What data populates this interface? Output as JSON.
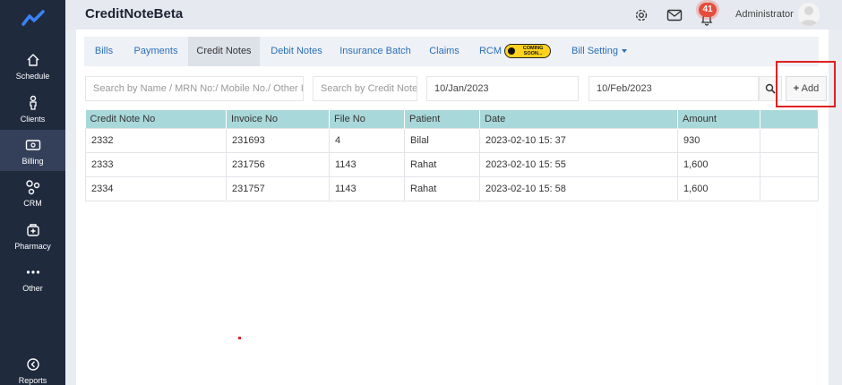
{
  "app": {
    "title": "CreditNoteBeta"
  },
  "sidebar": {
    "items": [
      {
        "label": "Schedule",
        "icon": "home-icon"
      },
      {
        "label": "Clients",
        "icon": "person-icon"
      },
      {
        "label": "Billing",
        "icon": "billing-icon"
      },
      {
        "label": "CRM",
        "icon": "crm-icon"
      },
      {
        "label": "Pharmacy",
        "icon": "pharmacy-icon"
      },
      {
        "label": "Other",
        "icon": "more-icon"
      },
      {
        "label": "Reports",
        "icon": "reports-icon"
      }
    ]
  },
  "header": {
    "notification_count": "41",
    "user_name": "Administrator"
  },
  "tabs": [
    {
      "label": "Bills"
    },
    {
      "label": "Payments"
    },
    {
      "label": "Credit Notes"
    },
    {
      "label": "Debit Notes"
    },
    {
      "label": "Insurance Batch"
    },
    {
      "label": "Claims"
    },
    {
      "label": "RCM"
    },
    {
      "label": "Bill Setting"
    }
  ],
  "coming_soon": {
    "line1": "COMING",
    "line2": "SOON..."
  },
  "filters": {
    "search_placeholder": "Search by Name / MRN No:/ Mobile No./ Other ID",
    "credit_note_placeholder": "Search by Credit Note",
    "from_date": "10/Jan/2023",
    "to_date": "10/Feb/2023",
    "add_label": "Add"
  },
  "table": {
    "columns": [
      "Credit Note No",
      "Invoice No",
      "File No",
      "Patient",
      "Date",
      "Amount",
      ""
    ],
    "rows": [
      [
        "2332",
        "231693",
        "4",
        "Bilal",
        "2023-02-10 15: 37",
        "930",
        ""
      ],
      [
        "2333",
        "231756",
        "1143",
        "Rahat",
        "2023-02-10 15: 55",
        "1,600",
        ""
      ],
      [
        "2334",
        "231757",
        "1143",
        "Rahat",
        "2023-02-10 15: 58",
        "1,600",
        ""
      ]
    ]
  },
  "colors": {
    "accent": "#2c6fb7",
    "sidebar": "#1f2a3d",
    "table_header": "#a9d8da",
    "badge": "#e74c3c",
    "highlight": "#e02020"
  }
}
